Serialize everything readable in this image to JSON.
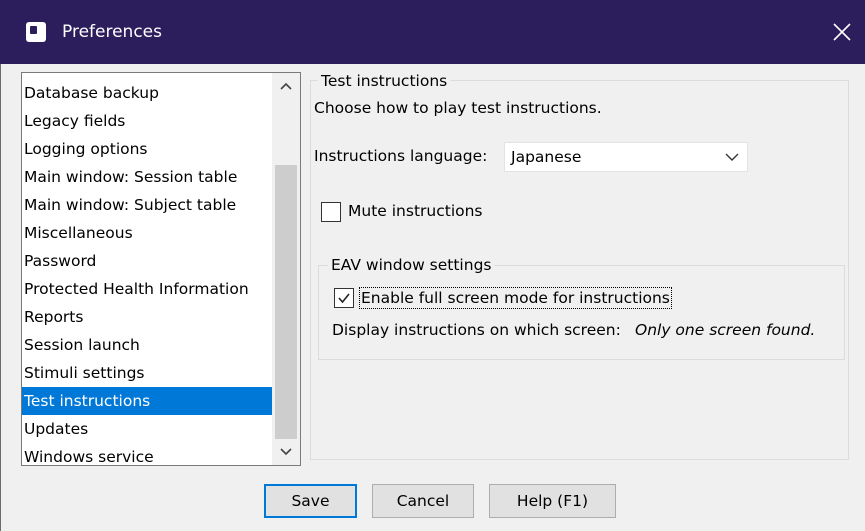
{
  "window": {
    "title": "Preferences",
    "close_icon": "close-icon"
  },
  "sidebar": {
    "items": [
      {
        "label": "Database backup"
      },
      {
        "label": "Legacy fields"
      },
      {
        "label": "Logging options"
      },
      {
        "label": "Main window: Session table"
      },
      {
        "label": "Main window: Subject table"
      },
      {
        "label": "Miscellaneous"
      },
      {
        "label": "Password"
      },
      {
        "label": "Protected Health Information"
      },
      {
        "label": "Reports"
      },
      {
        "label": "Session launch"
      },
      {
        "label": "Stimuli settings"
      },
      {
        "label": "Test instructions",
        "selected": true
      },
      {
        "label": "Updates"
      },
      {
        "label": "Windows service"
      }
    ],
    "selected": "Test instructions"
  },
  "panel": {
    "title": "Test instructions",
    "description": "Choose how to play test instructions.",
    "language_label": "Instructions language:",
    "language_value": "Japanese",
    "mute_label": "Mute instructions",
    "mute_checked": false,
    "eav": {
      "title": "EAV window settings",
      "fullscreen_label": "Enable full screen mode for instructions",
      "fullscreen_checked": true,
      "screen_label": "Display instructions on which screen:",
      "screen_value": "Only one screen found."
    }
  },
  "buttons": {
    "save": "Save",
    "cancel": "Cancel",
    "help": "Help (F1)"
  },
  "colors": {
    "titlebar": "#2c1e5c",
    "selection": "#0078d7"
  }
}
